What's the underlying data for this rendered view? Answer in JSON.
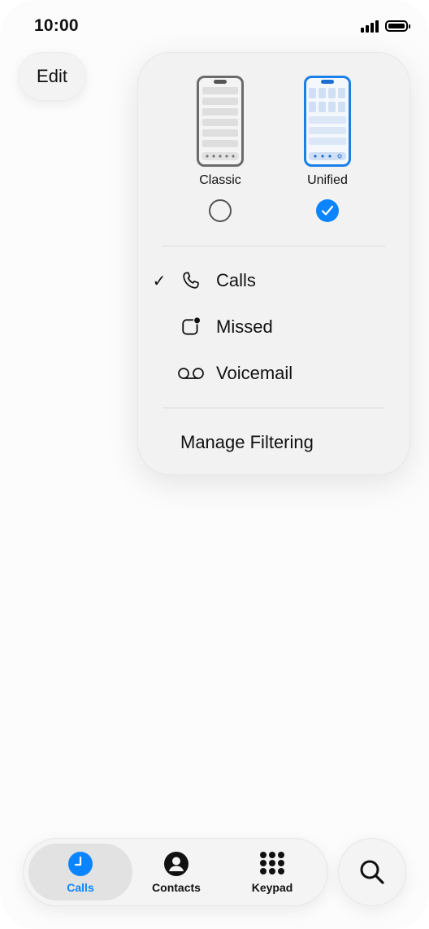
{
  "status_bar": {
    "time": "10:00"
  },
  "edit_label": "Edit",
  "layout_menu": {
    "options": [
      {
        "label": "Classic",
        "selected": false
      },
      {
        "label": "Unified",
        "selected": true
      }
    ],
    "filters": [
      {
        "label": "Calls",
        "icon": "phone-icon",
        "checked": true
      },
      {
        "label": "Missed",
        "icon": "missed-badge-icon",
        "checked": false
      },
      {
        "label": "Voicemail",
        "icon": "voicemail-icon",
        "checked": false
      }
    ],
    "manage_label": "Manage Filtering",
    "check_glyph": "✓"
  },
  "tabs": [
    {
      "label": "Calls",
      "icon": "clock-icon",
      "active": true
    },
    {
      "label": "Contacts",
      "icon": "person-circle-icon",
      "active": false
    },
    {
      "label": "Keypad",
      "icon": "keypad-icon",
      "active": false
    }
  ],
  "colors": {
    "accent": "#0a84ff",
    "background": "#fcfcfc",
    "menu_bg": "#f2f2f2"
  }
}
